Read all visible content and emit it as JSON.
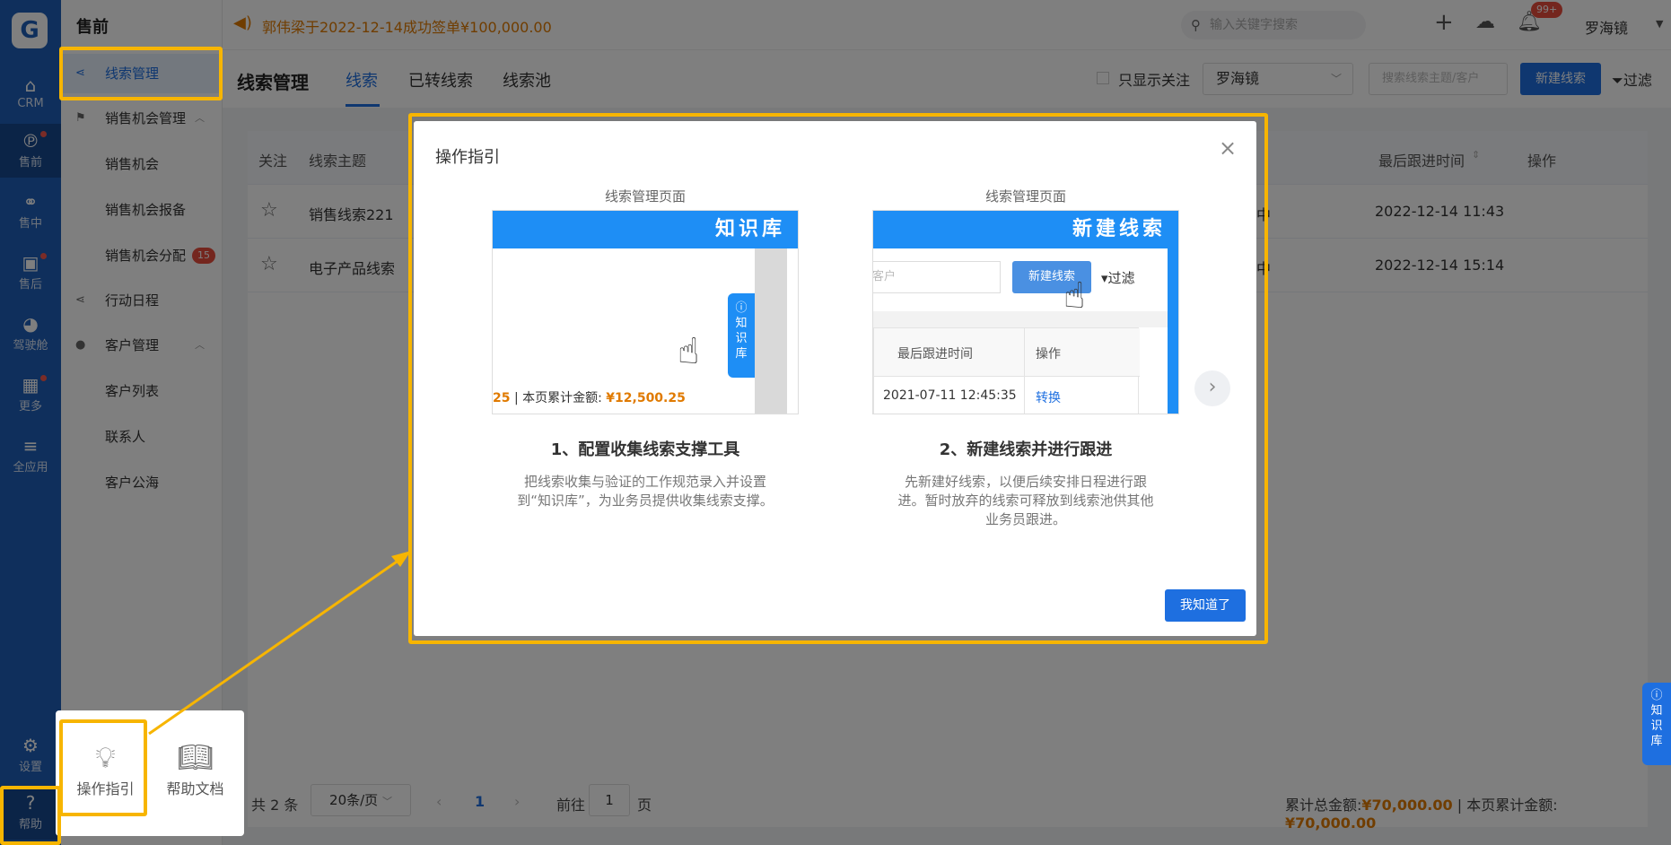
{
  "rail": {
    "logo": "G",
    "items": [
      {
        "label": "CRM",
        "icon": "home-icon",
        "glyph": "⌂"
      },
      {
        "label": "售前",
        "icon": "pinterest-icon",
        "glyph": "℗"
      },
      {
        "label": "售中",
        "icon": "handshake-icon",
        "glyph": "⚭"
      },
      {
        "label": "售后",
        "icon": "clipboard-icon",
        "glyph": "▣"
      },
      {
        "label": "驾驶舱",
        "icon": "dashboard-icon",
        "glyph": "◕"
      },
      {
        "label": "更多",
        "icon": "grid-icon",
        "glyph": "▦"
      },
      {
        "label": "全应用",
        "icon": "menu-icon",
        "glyph": "≡"
      },
      {
        "label": "设置",
        "icon": "gear-icon",
        "glyph": "⚙"
      },
      {
        "label": "帮助",
        "icon": "help-icon",
        "glyph": "?"
      }
    ]
  },
  "menu": {
    "title": "售前",
    "items": [
      {
        "label": "线索管理"
      },
      {
        "label": "销售机会管理"
      },
      {
        "label": "销售机会"
      },
      {
        "label": "销售机会报备"
      },
      {
        "label": "销售机会分配",
        "badge": "15"
      },
      {
        "label": "行动日程"
      },
      {
        "label": "客户管理"
      },
      {
        "label": "客户列表"
      },
      {
        "label": "联系人"
      },
      {
        "label": "客户公海"
      }
    ]
  },
  "topbar": {
    "notice": "郭伟梁于2022-12-14成功签单¥100,000.00",
    "search_placeholder": "输入关键字搜索",
    "bell_badge": "99+",
    "username": "罗海镜"
  },
  "header": {
    "title": "线索管理",
    "tabs": [
      "线索",
      "已转线索",
      "线索池"
    ],
    "only_follow": "只显示关注",
    "owner_select": "罗海镜",
    "search_placeholder": "搜索线索主题/客户",
    "new_button": "新建线索",
    "filter": "过滤"
  },
  "table": {
    "columns": [
      "关注",
      "线索主题",
      "最后跟进时间",
      "操作"
    ],
    "rows": [
      {
        "subject": "销售线索221",
        "stage": "中",
        "last_follow": "2022-12-14 11:43"
      },
      {
        "subject": "电子产品线索",
        "stage": "中",
        "last_follow": "2022-12-14 15:14"
      }
    ]
  },
  "footer": {
    "total": "共 2 条",
    "page_size": "20条/页",
    "current_page": "1",
    "goto_label": "前往",
    "goto_value": "1",
    "page_unit": "页",
    "total_amount_label": "累计总金额:",
    "total_amount": "¥70,000.00",
    "page_amount_label": "| 本页累计金额:",
    "page_amount": "¥70,000.00"
  },
  "help_popup": {
    "guide": "操作指引",
    "docs": "帮助文档"
  },
  "modal": {
    "title": "操作指引",
    "steps": [
      {
        "caption": "线索管理页面",
        "banner": "知识库",
        "kb_tab": "知识库",
        "amount_prefix": "25",
        "amount_label": "| 本页累计金额:",
        "amount_value": "¥12,500.25",
        "title": "1、配置收集线索支撑工具",
        "desc": "把线索收集与验证的工作规范录入并设置到“知识库”，为业务员提供收集线索支撑。"
      },
      {
        "caption": "线索管理页面",
        "banner": "新建线索",
        "input_placeholder": "客户",
        "new_button": "新建线索",
        "filter": "过滤",
        "col1": "最后跟进时间",
        "col2": "操作",
        "row_time": "2021-07-11 12:45:35",
        "row_action": "转换",
        "title": "2、新建线索并进行跟进",
        "desc": "先新建好线索，以便后续安排日程进行跟进。暂时放弃的线索可释放到线索池供其他业务员跟进。"
      }
    ],
    "got_it": "我知道了"
  },
  "side_kb": "知识库",
  "colors": {
    "primary": "#1e6fe0",
    "rail": "#1e5fb8",
    "highlight": "#f7b500",
    "amount": "#e07a00"
  }
}
